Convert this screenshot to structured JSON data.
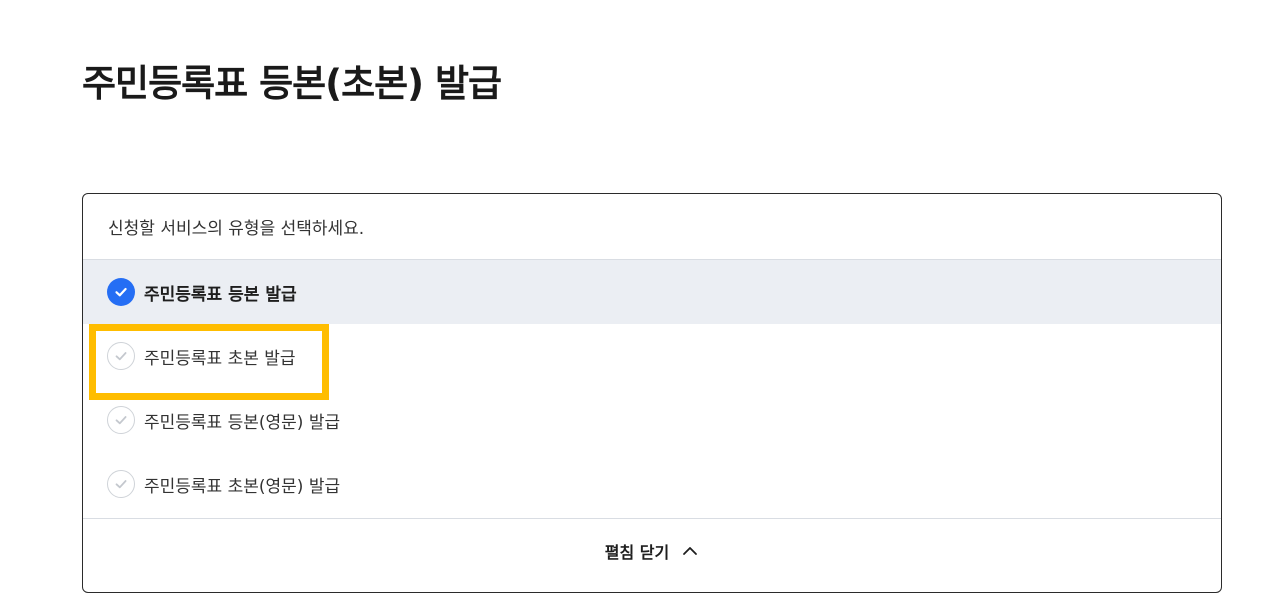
{
  "page": {
    "title": "주민등록표 등본(초본) 발급"
  },
  "service_select": {
    "prompt": "신청할 서비스의 유형을 선택하세요.",
    "options": [
      {
        "label": "주민등록표 등본 발급",
        "selected": true
      },
      {
        "label": "주민등록표 초본 발급",
        "selected": false,
        "highlighted": true
      },
      {
        "label": "주민등록표 등본(영문) 발급",
        "selected": false
      },
      {
        "label": "주민등록표 초본(영문) 발급",
        "selected": false
      }
    ],
    "toggle_label": "펼침 닫기"
  },
  "colors": {
    "accent": "#256ef4",
    "selected_bg": "#ebeef3",
    "highlight": "#ffbd00"
  },
  "icons": {
    "check": "check-circle-icon",
    "collapse": "chevron-up-icon"
  }
}
